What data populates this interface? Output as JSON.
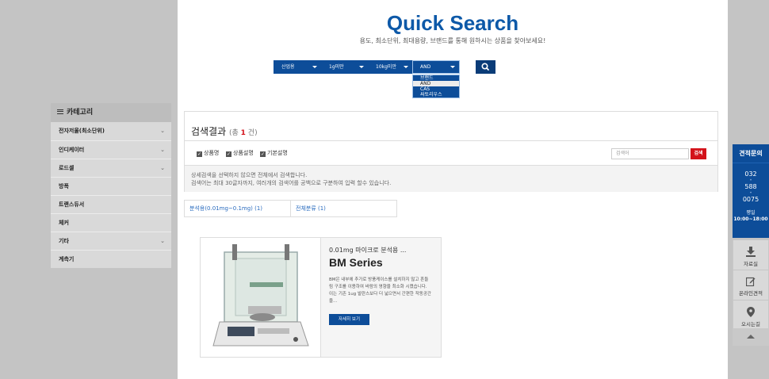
{
  "hero": {
    "title": "Quick Search",
    "subtitle": "용도, 최소단위, 최대용량, 브랜드를 통해 원하시는 상품을 찾아보세요!"
  },
  "search": {
    "use": "산업용",
    "min_unit": "1g미만",
    "max_capacity": "10kg미만",
    "brand": "AND",
    "brand_options": [
      "브랜드",
      "AND",
      "CAS",
      "싸토리우스"
    ],
    "brand_highlighted": "AND",
    "search_icon": "search-icon"
  },
  "results": {
    "title": "검색결과",
    "count_prefix": "(총 ",
    "count": "1",
    "count_suffix": " 건)",
    "filters": [
      "상품명",
      "상품설명",
      "기본설명"
    ],
    "keyword_placeholder": "검색어",
    "keyword_button": "검색",
    "info_line1": "상세검색을 선택하지 않으면 전체에서 검색합니다.",
    "info_line2": "검색어는 최대 30글자까지, 여러개의 검색어를 공백으로 구분하여 입력 할수 있습니다."
  },
  "categories": [
    "분석용(0.01mg~0.1mg) (1)",
    "전체분류 (1)"
  ],
  "product": {
    "desc_short": "0.01mg 마이크로 분석용 ...",
    "name": "BM Series",
    "desc_long": "BM은 내부에 추가로 방풍케이스를 설치하지 않고 흔들림 구조를 이용하여 바람의 영향을 최소화 시켰습니다. 이는 기존 1ug 발란스보다 더 넓으면서 간편한 작동공간을...",
    "detail_button": "자세히 보기"
  },
  "sidebar": {
    "header": "카테고리",
    "items": [
      {
        "label": "전자저울(최소단위)",
        "has_children": true
      },
      {
        "label": "인디케이터",
        "has_children": true
      },
      {
        "label": "로드셀",
        "has_children": true
      },
      {
        "label": "방폭",
        "has_children": false
      },
      {
        "label": "트랜스듀서",
        "has_children": false
      },
      {
        "label": "체커",
        "has_children": false
      },
      {
        "label": "기타",
        "has_children": true
      },
      {
        "label": "계측기",
        "has_children": false
      }
    ]
  },
  "quote": {
    "title": "견적문의",
    "phone": [
      "032",
      "588",
      "0075"
    ],
    "hours_label": "평일",
    "hours": "10:00~18:00"
  },
  "quick_menu": [
    "자료실",
    "온라인견적",
    "오시는길"
  ],
  "colors": {
    "brand_blue": "#0d4d99",
    "accent_red": "#d3121a",
    "title_blue": "#0d59a8"
  }
}
